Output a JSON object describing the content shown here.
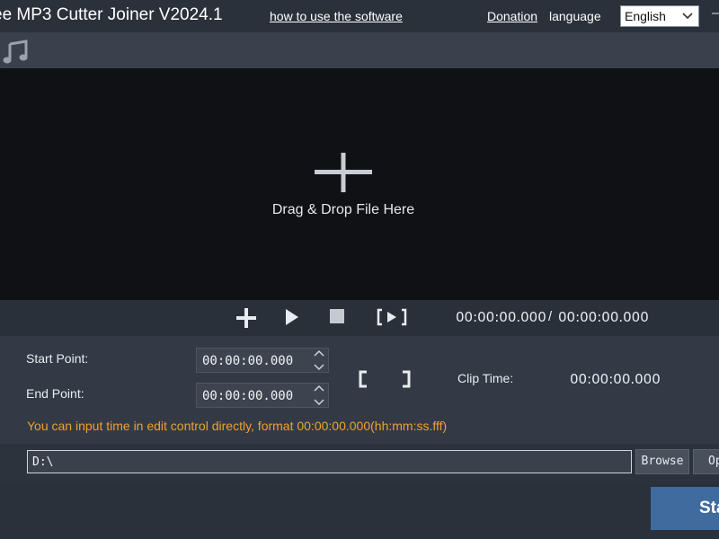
{
  "header": {
    "app_title": "ee MP3 Cutter Joiner V2024.1",
    "howto_link": "how to use the software",
    "donation_link": "Donation",
    "language_label": "language",
    "language_selected": "English",
    "corner_glyph": "–"
  },
  "drop_area": {
    "text": "Drag & Drop File Here"
  },
  "player": {
    "current_time": "00:00:00.000",
    "separator": "/",
    "total_time": "00:00:00.000"
  },
  "cut_settings": {
    "start_label": "Start Point:",
    "start_value": "00:00:00.000",
    "end_label": "End Point:",
    "end_value": "00:00:00.000",
    "clip_time_label": "Clip Time:",
    "clip_time_value": "00:00:00.000",
    "hint": "You can input time in edit control directly, format 00:00:00.000(hh:mm:ss.fff)"
  },
  "output": {
    "path_value": "D:\\",
    "browse_label": "Browse",
    "open_label": "Op"
  },
  "actions": {
    "start_label": "Sta"
  },
  "colors": {
    "hint_text": "#f0a030",
    "start_button": "#3f6b9e",
    "drop_area_bg": "#0f1115"
  }
}
